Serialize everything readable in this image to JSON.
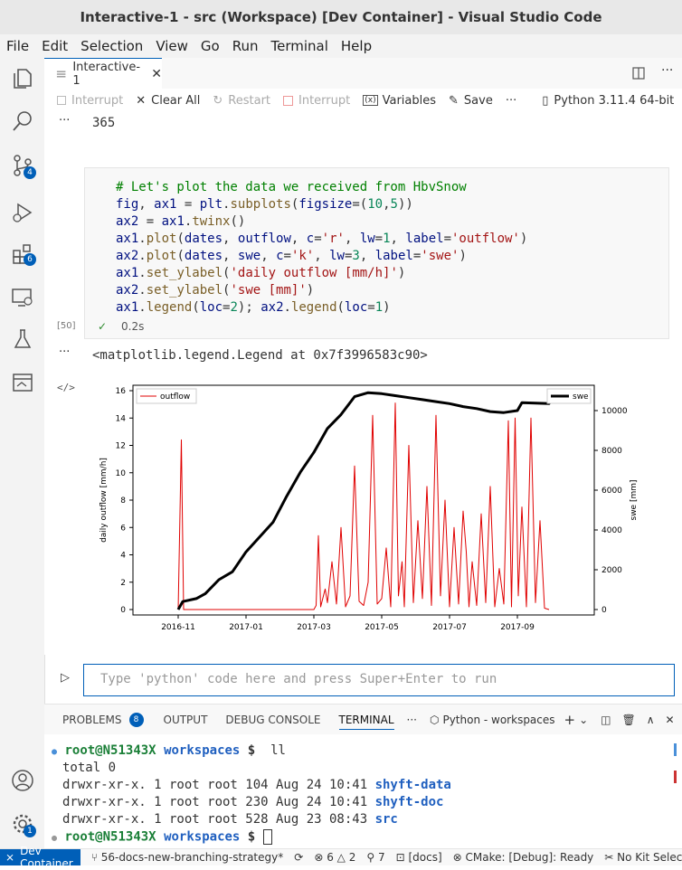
{
  "window": {
    "title": "Interactive-1 - src (Workspace) [Dev Container] - Visual Studio Code"
  },
  "menu": [
    "File",
    "Edit",
    "Selection",
    "View",
    "Go",
    "Run",
    "Terminal",
    "Help"
  ],
  "activity": {
    "scm_badge": "4",
    "extensions_badge": "6",
    "accounts_badge": "1"
  },
  "tab": {
    "label": "Interactive-1"
  },
  "toolbar": {
    "interrupt1": "Interrupt",
    "clear_all": "Clear All",
    "restart": "Restart",
    "interrupt2": "Interrupt",
    "variables": "Variables",
    "save": "Save",
    "more": "···",
    "kernel": "Python 3.11.4 64-bit"
  },
  "cells": {
    "prev_output": "365",
    "exec_count": "[50]",
    "duration": "0.2s",
    "code_lines": [
      "# Let's plot the data we received from HbvSnow",
      "fig, ax1 = plt.subplots(figsize=(10,5))",
      "ax2 = ax1.twinx()",
      "ax1.plot(dates, outflow, c='r', lw=1, label='outflow')",
      "ax2.plot(dates, swe, c='k', lw=3, label='swe')",
      "ax1.set_ylabel('daily outflow [mm/h]')",
      "ax2.set_ylabel('swe [mm]')",
      "ax1.legend(loc=2); ax2.legend(loc=1)"
    ],
    "output_text": "<matplotlib.legend.Legend at 0x7f3996583c90>"
  },
  "chart_data": {
    "type": "line",
    "x_ticks": [
      "2016-11",
      "2017-01",
      "2017-03",
      "2017-05",
      "2017-07",
      "2017-09"
    ],
    "y_left": {
      "label": "daily outflow [mm/h]",
      "ticks": [
        0,
        2,
        4,
        6,
        8,
        10,
        12,
        14,
        16
      ],
      "range": [
        0,
        16
      ]
    },
    "y_right": {
      "label": "swe [mm]",
      "ticks": [
        0,
        2000,
        4000,
        6000,
        8000,
        10000
      ],
      "range": [
        0,
        11000
      ]
    },
    "series": [
      {
        "name": "outflow",
        "color": "#e00000",
        "axis": "left",
        "points": [
          [
            0,
            0
          ],
          [
            0.7,
            12.4
          ],
          [
            1.2,
            0
          ],
          [
            30,
            0
          ],
          [
            30.5,
            0.3
          ],
          [
            31,
            5.4
          ],
          [
            31.5,
            0.2
          ],
          [
            32.5,
            1.5
          ],
          [
            33,
            0.5
          ],
          [
            34,
            3.5
          ],
          [
            35,
            0.4
          ],
          [
            36,
            6
          ],
          [
            37,
            0.2
          ],
          [
            38,
            1
          ],
          [
            39,
            10.5
          ],
          [
            40,
            0.6
          ],
          [
            41,
            0.3
          ],
          [
            42,
            2
          ],
          [
            43,
            14.2
          ],
          [
            44,
            0.4
          ],
          [
            45,
            0.8
          ],
          [
            46,
            4.5
          ],
          [
            47,
            0.2
          ],
          [
            48,
            15.1
          ],
          [
            48.7,
            1
          ],
          [
            49.5,
            3.5
          ],
          [
            50,
            0.2
          ],
          [
            51,
            12
          ],
          [
            52,
            0.5
          ],
          [
            53,
            6.5
          ],
          [
            54,
            0.8
          ],
          [
            55,
            9
          ],
          [
            56,
            0.3
          ],
          [
            57,
            14.2
          ],
          [
            58,
            1
          ],
          [
            59,
            8
          ],
          [
            60,
            0.2
          ],
          [
            61,
            6
          ],
          [
            62,
            0.4
          ],
          [
            63,
            7.2
          ],
          [
            63.7,
            4.2
          ],
          [
            64.3,
            0.2
          ],
          [
            65,
            3.5
          ],
          [
            66,
            0.3
          ],
          [
            67,
            7
          ],
          [
            68,
            0.5
          ],
          [
            69,
            9
          ],
          [
            70,
            0.2
          ],
          [
            71,
            3
          ],
          [
            72,
            0.4
          ],
          [
            73,
            13.8
          ],
          [
            73.7,
            0.2
          ],
          [
            74.5,
            14
          ],
          [
            75.2,
            1
          ],
          [
            76,
            7.5
          ],
          [
            77,
            0.2
          ],
          [
            78,
            14
          ],
          [
            79,
            0.5
          ],
          [
            80,
            6.5
          ],
          [
            81,
            0.1
          ],
          [
            82,
            0
          ]
        ]
      },
      {
        "name": "swe",
        "color": "#000000",
        "axis": "right",
        "points": [
          [
            0,
            0
          ],
          [
            1,
            400
          ],
          [
            4,
            550
          ],
          [
            6,
            800
          ],
          [
            9,
            1500
          ],
          [
            12,
            1900
          ],
          [
            15,
            2900
          ],
          [
            18,
            3650
          ],
          [
            21,
            4400
          ],
          [
            24,
            5700
          ],
          [
            27,
            6900
          ],
          [
            30,
            7900
          ],
          [
            33,
            9100
          ],
          [
            36,
            9800
          ],
          [
            39,
            10700
          ],
          [
            42,
            10900
          ],
          [
            45,
            10850
          ],
          [
            48,
            10750
          ],
          [
            51,
            10650
          ],
          [
            54,
            10550
          ],
          [
            57,
            10450
          ],
          [
            60,
            10350
          ],
          [
            63,
            10200
          ],
          [
            66,
            10100
          ],
          [
            69,
            9950
          ],
          [
            72,
            9900
          ],
          [
            75,
            10000
          ],
          [
            76,
            10400
          ],
          [
            82,
            10350
          ],
          [
            83,
            10700
          ]
        ]
      }
    ],
    "legend_left": "outflow",
    "legend_right": "swe"
  },
  "input": {
    "placeholder": "Type 'python' code here and press Super+Enter to run"
  },
  "panel": {
    "tabs": [
      "PROBLEMS",
      "OUTPUT",
      "DEBUG CONSOLE",
      "TERMINAL"
    ],
    "problems_count": "8",
    "terminal_name": "Python - workspaces"
  },
  "terminal": {
    "prompt": "root@N51343X",
    "dir": "workspaces",
    "cmd": "ll",
    "lines": [
      {
        "text": "total 0",
        "name": ""
      },
      {
        "text": "drwxr-xr-x. 1 root root 104 Aug 24 10:41 ",
        "name": "shyft-data"
      },
      {
        "text": "drwxr-xr-x. 1 root root 230 Aug 24 10:41 ",
        "name": "shyft-doc"
      },
      {
        "text": "drwxr-xr-x. 1 root root 528 Aug 23 08:43 ",
        "name": "src"
      }
    ]
  },
  "status": {
    "remote": "Dev Container",
    "branch": "56-docs-new-branching-strategy*",
    "errors": "6",
    "warnings": "2",
    "ports": "7",
    "docs": "[docs]",
    "cmake": "CMake: [Debug]: Ready",
    "kit": "No Kit Selected"
  }
}
